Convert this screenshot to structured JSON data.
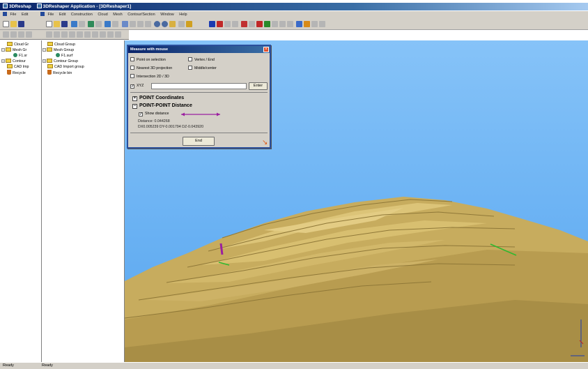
{
  "app": {
    "back_window_title": "3DReshap",
    "title": "3DReshaper Application - [3DReshaper1]"
  },
  "menu": {
    "back_items": [
      "File",
      "Edit"
    ],
    "items": [
      "File",
      "Edit",
      "Construction",
      "Cloud",
      "Mesh",
      "Contour/Section",
      "Window",
      "Help"
    ]
  },
  "tree_back": {
    "items": [
      {
        "label": "Cloud Gr"
      },
      {
        "label": "Mesh Gr"
      },
      {
        "label": "F1.sr"
      },
      {
        "label": "Contour"
      },
      {
        "label": "CAD Imp"
      },
      {
        "label": "Recycle"
      }
    ]
  },
  "tree": {
    "items": [
      {
        "label": "Cloud Group"
      },
      {
        "label": "Mesh Group"
      },
      {
        "label": "F1.surf"
      },
      {
        "label": "Contour Group"
      },
      {
        "label": "CAD Import group"
      },
      {
        "label": "Recycle bin"
      }
    ]
  },
  "dialog": {
    "title": "Measure with mouse",
    "close": "×",
    "options": {
      "point_on_selection": "Point on selection",
      "vertex_end": "Vertex / End",
      "nearest_3d": "Nearest 3D projection",
      "middle_center": "Middle/center",
      "intersection": "Intersection 2D / 3D",
      "xyz": "XYZ"
    },
    "xyz_value": "",
    "enter_button": "Enter",
    "section_point_coords": "POINT Coordinates",
    "section_point_coords_toggle": "+",
    "section_distance": "POINT-POINT Distance",
    "section_distance_toggle": "−",
    "show_distance": "Show distance",
    "distance": "Distance: 0.044268",
    "deltas": "DX0.005239   DY-0.001794   DZ-0.043920",
    "end_button": "End"
  },
  "status": {
    "left": "Ready",
    "right": "Ready"
  },
  "colors": {
    "sky": "#6fb6f4",
    "terrain": "#c7ac5e",
    "terrain_dark": "#9e8640",
    "accent_purple": "#9b1fa0",
    "measure_green": "#2fb82f"
  }
}
